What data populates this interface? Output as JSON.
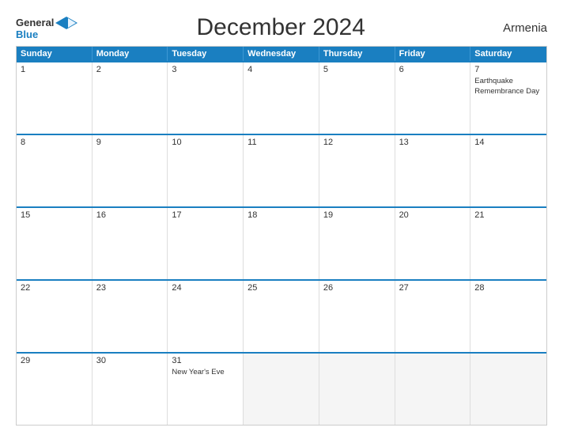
{
  "header": {
    "title": "December 2024",
    "country": "Armenia",
    "logo_general": "General",
    "logo_blue": "Blue"
  },
  "calendar": {
    "day_headers": [
      "Sunday",
      "Monday",
      "Tuesday",
      "Wednesday",
      "Thursday",
      "Friday",
      "Saturday"
    ],
    "weeks": [
      [
        {
          "date": "1",
          "event": "",
          "empty": false
        },
        {
          "date": "2",
          "event": "",
          "empty": false
        },
        {
          "date": "3",
          "event": "",
          "empty": false
        },
        {
          "date": "4",
          "event": "",
          "empty": false
        },
        {
          "date": "5",
          "event": "",
          "empty": false
        },
        {
          "date": "6",
          "event": "",
          "empty": false
        },
        {
          "date": "7",
          "event": "Earthquake Remembrance Day",
          "empty": false
        }
      ],
      [
        {
          "date": "8",
          "event": "",
          "empty": false
        },
        {
          "date": "9",
          "event": "",
          "empty": false
        },
        {
          "date": "10",
          "event": "",
          "empty": false
        },
        {
          "date": "11",
          "event": "",
          "empty": false
        },
        {
          "date": "12",
          "event": "",
          "empty": false
        },
        {
          "date": "13",
          "event": "",
          "empty": false
        },
        {
          "date": "14",
          "event": "",
          "empty": false
        }
      ],
      [
        {
          "date": "15",
          "event": "",
          "empty": false
        },
        {
          "date": "16",
          "event": "",
          "empty": false
        },
        {
          "date": "17",
          "event": "",
          "empty": false
        },
        {
          "date": "18",
          "event": "",
          "empty": false
        },
        {
          "date": "19",
          "event": "",
          "empty": false
        },
        {
          "date": "20",
          "event": "",
          "empty": false
        },
        {
          "date": "21",
          "event": "",
          "empty": false
        }
      ],
      [
        {
          "date": "22",
          "event": "",
          "empty": false
        },
        {
          "date": "23",
          "event": "",
          "empty": false
        },
        {
          "date": "24",
          "event": "",
          "empty": false
        },
        {
          "date": "25",
          "event": "",
          "empty": false
        },
        {
          "date": "26",
          "event": "",
          "empty": false
        },
        {
          "date": "27",
          "event": "",
          "empty": false
        },
        {
          "date": "28",
          "event": "",
          "empty": false
        }
      ],
      [
        {
          "date": "29",
          "event": "",
          "empty": false
        },
        {
          "date": "30",
          "event": "",
          "empty": false
        },
        {
          "date": "31",
          "event": "New Year's Eve",
          "empty": false
        },
        {
          "date": "",
          "event": "",
          "empty": true
        },
        {
          "date": "",
          "event": "",
          "empty": true
        },
        {
          "date": "",
          "event": "",
          "empty": true
        },
        {
          "date": "",
          "event": "",
          "empty": true
        }
      ]
    ]
  }
}
